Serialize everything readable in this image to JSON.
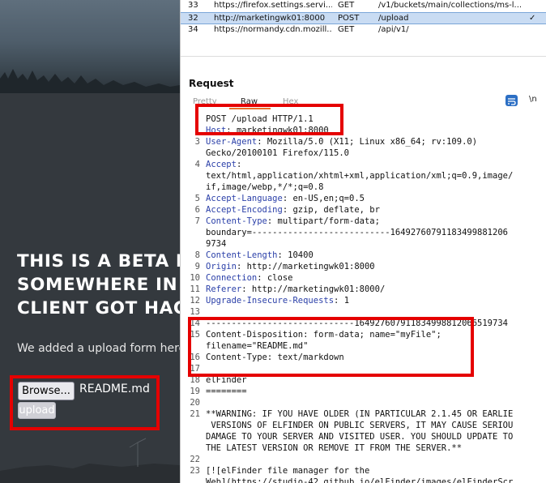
{
  "website": {
    "headline": [
      "THIS IS A BETA P",
      "SOMEWHERE IN",
      "CLIENT GOT HAC"
    ],
    "subtext": "We added a upload form here",
    "browse_label": "Browse...",
    "file_name": "README.md",
    "upload_label": "upload"
  },
  "burp": {
    "history": [
      {
        "num": "33",
        "host": "https://firefox.settings.servi...",
        "method": "GET",
        "url": "/v1/buckets/main/collections/ms-l...",
        "check": "",
        "selected": false
      },
      {
        "num": "32",
        "host": "http://marketingwk01:8000",
        "method": "POST",
        "url": "/upload",
        "check": "✓",
        "selected": true
      },
      {
        "num": "34",
        "host": "https://normandy.cdn.mozill...",
        "method": "GET",
        "url": "/api/v1/",
        "check": "",
        "selected": false
      }
    ],
    "request_title": "Request",
    "tabs": {
      "pretty": "Pretty",
      "raw": "Raw",
      "hex": "Hex"
    },
    "newline_toggle": "\\n",
    "lines": [
      {
        "n": "",
        "k": "",
        "v": "POST /upload HTTP/1.1"
      },
      {
        "n": "",
        "k": "Host",
        "v": ": marketingwk01:8000"
      },
      {
        "n": "3",
        "k": "User-Agent",
        "v": ": Mozilla/5.0 (X11; Linux x86_64; rv:109.0)"
      },
      {
        "n": "",
        "k": "",
        "v": "Gecko/20100101 Firefox/115.0"
      },
      {
        "n": "4",
        "k": "Accept",
        "v": ":"
      },
      {
        "n": "",
        "k": "",
        "v": "text/html,application/xhtml+xml,application/xml;q=0.9,image/"
      },
      {
        "n": "",
        "k": "",
        "v": "if,image/webp,*/*;q=0.8"
      },
      {
        "n": "5",
        "k": "Accept-Language",
        "v": ": en-US,en;q=0.5"
      },
      {
        "n": "6",
        "k": "Accept-Encoding",
        "v": ": gzip, deflate, br"
      },
      {
        "n": "7",
        "k": "Content-Type",
        "v": ": multipart/form-data;"
      },
      {
        "n": "",
        "k": "",
        "v": "boundary=---------------------------16492760791183499881206"
      },
      {
        "n": "",
        "k": "",
        "v": "9734"
      },
      {
        "n": "8",
        "k": "Content-Length",
        "v": ": 10400"
      },
      {
        "n": "9",
        "k": "Origin",
        "v": ": http://marketingwk01:8000"
      },
      {
        "n": "10",
        "k": "Connection",
        "v": ": close"
      },
      {
        "n": "11",
        "k": "Referer",
        "v": ": http://marketingwk01:8000/"
      },
      {
        "n": "12",
        "k": "Upgrade-Insecure-Requests",
        "v": ": 1"
      },
      {
        "n": "13",
        "k": "",
        "v": ""
      },
      {
        "n": "14",
        "k": "",
        "v": "-----------------------------164927607911834998812066519734"
      },
      {
        "n": "15",
        "k": "",
        "v": "Content-Disposition: form-data; name=\"myFile\";"
      },
      {
        "n": "",
        "k": "",
        "v": "filename=\"README.md\""
      },
      {
        "n": "16",
        "k": "",
        "v": "Content-Type: text/markdown"
      },
      {
        "n": "17",
        "k": "",
        "v": ""
      },
      {
        "n": "18",
        "k": "",
        "v": "elFinder"
      },
      {
        "n": "19",
        "k": "",
        "v": "========"
      },
      {
        "n": "20",
        "k": "",
        "v": ""
      },
      {
        "n": "21",
        "k": "",
        "v": "**WARNING: IF YOU HAVE OLDER (IN PARTICULAR 2.1.45 OR EARLIE"
      },
      {
        "n": "",
        "k": "",
        "v": " VERSIONS OF ELFINDER ON PUBLIC SERVERS, IT MAY CAUSE SERIOU"
      },
      {
        "n": "",
        "k": "",
        "v": "DAMAGE TO YOUR SERVER AND VISITED USER. YOU SHOULD UPDATE TO"
      },
      {
        "n": "",
        "k": "",
        "v": "THE LATEST VERSION OR REMOVE IT FROM THE SERVER.**"
      },
      {
        "n": "22",
        "k": "",
        "v": ""
      },
      {
        "n": "23",
        "k": "",
        "v": "[![elFinder file manager for the"
      },
      {
        "n": "",
        "k": "",
        "v": "Web](https://studio-42.github.io/elFinder/images/elFinderScr"
      }
    ]
  }
}
